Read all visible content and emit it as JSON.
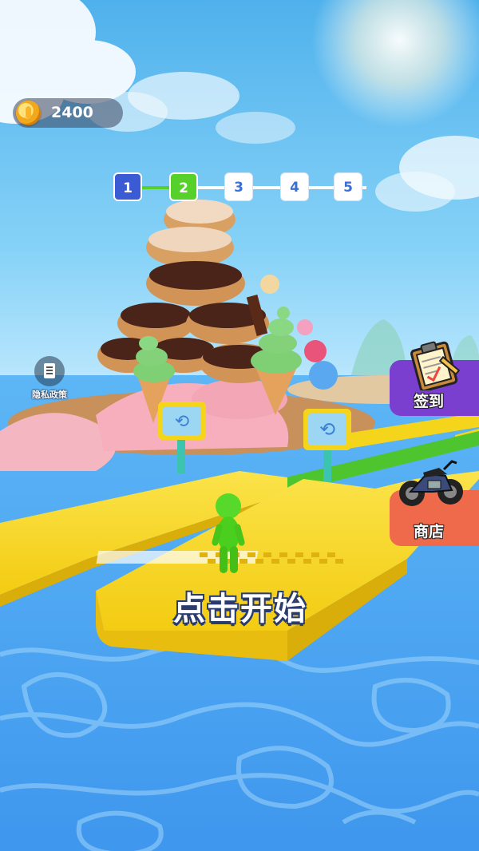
{
  "hud": {
    "coins": "2400",
    "coin_icon": "coin-icon"
  },
  "levels": {
    "items": [
      "1",
      "2",
      "3",
      "4",
      "5"
    ],
    "completed_count": 1,
    "current": "2",
    "colors": {
      "done": "#3b5bd4",
      "current": "#56d12b",
      "todo": "#ffffff"
    }
  },
  "privacy": {
    "label": "隐私政策",
    "icon": "document-icon"
  },
  "side_buttons": {
    "checkin": {
      "label": "签到",
      "icon": "clipboard-icon",
      "color": "#7b3fd0"
    },
    "shop": {
      "label": "商店",
      "icon": "motorcycle-icon",
      "color": "#ee6a4a"
    }
  },
  "start_prompt": "点击开始",
  "scene": {
    "sky_color": "#6fc4f4",
    "water_color": "#4aa3f3",
    "track_color": "#f5d51c",
    "player_color": "#4bdc1d"
  }
}
